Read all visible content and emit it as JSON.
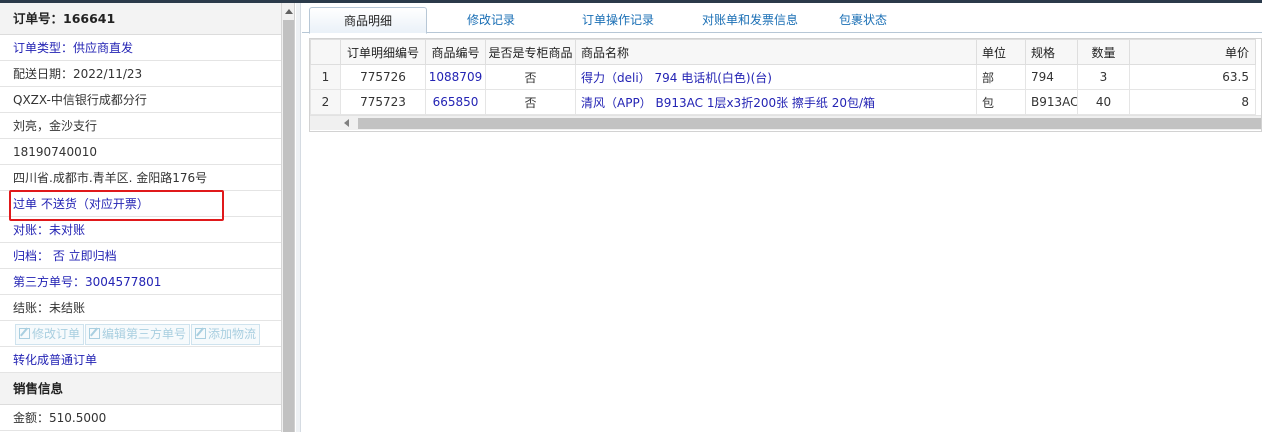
{
  "order_panel": {
    "title": "订单号：166641",
    "order_type": "订单类型：供应商直发",
    "delivery_date": "配送日期：2022/11/23",
    "customer": "QXZX-中信银行成都分行",
    "contact": "刘亮，金沙支行",
    "phone": "18190740010",
    "address": "四川省.成都市.青羊区. 金阳路176号",
    "order_status": "过单 不送货（对应开票）",
    "reconciliation": "对账：未对账",
    "archive": "归档： 否 立即归档",
    "third_party": "第三方单号：3004577801",
    "settlement": "结账：未结账",
    "buttons": [
      "修改订单",
      "编辑第三方单号",
      "添加物流"
    ],
    "convert_link": "转化成普通订单",
    "sales_header": "销售信息",
    "amount": "金额：510.5000"
  },
  "tabs": [
    "商品明细",
    "修改记录",
    "订单操作记录",
    "对账单和发票信息",
    "包裹状态"
  ],
  "table": {
    "columns": [
      "",
      "订单明细编号",
      "商品编号",
      "是否是专柜商品",
      "商品名称",
      "单位",
      "规格",
      "数量",
      "单价"
    ],
    "rows": [
      [
        "1",
        "775726",
        "1088709",
        "否",
        "得力（deli） 794 电话机(白色)(台)",
        "部",
        "794",
        "3",
        "63.5"
      ],
      [
        "2",
        "775723",
        "665850",
        "否",
        "清风（APP） B913AC 1层x3折200张 擦手纸 20包/箱",
        "包",
        "B913AC",
        "40",
        "8"
      ]
    ]
  },
  "colors": {
    "link": "#2323b4",
    "highlight": "#e0191b",
    "tab_text": "#1a6fb5"
  }
}
